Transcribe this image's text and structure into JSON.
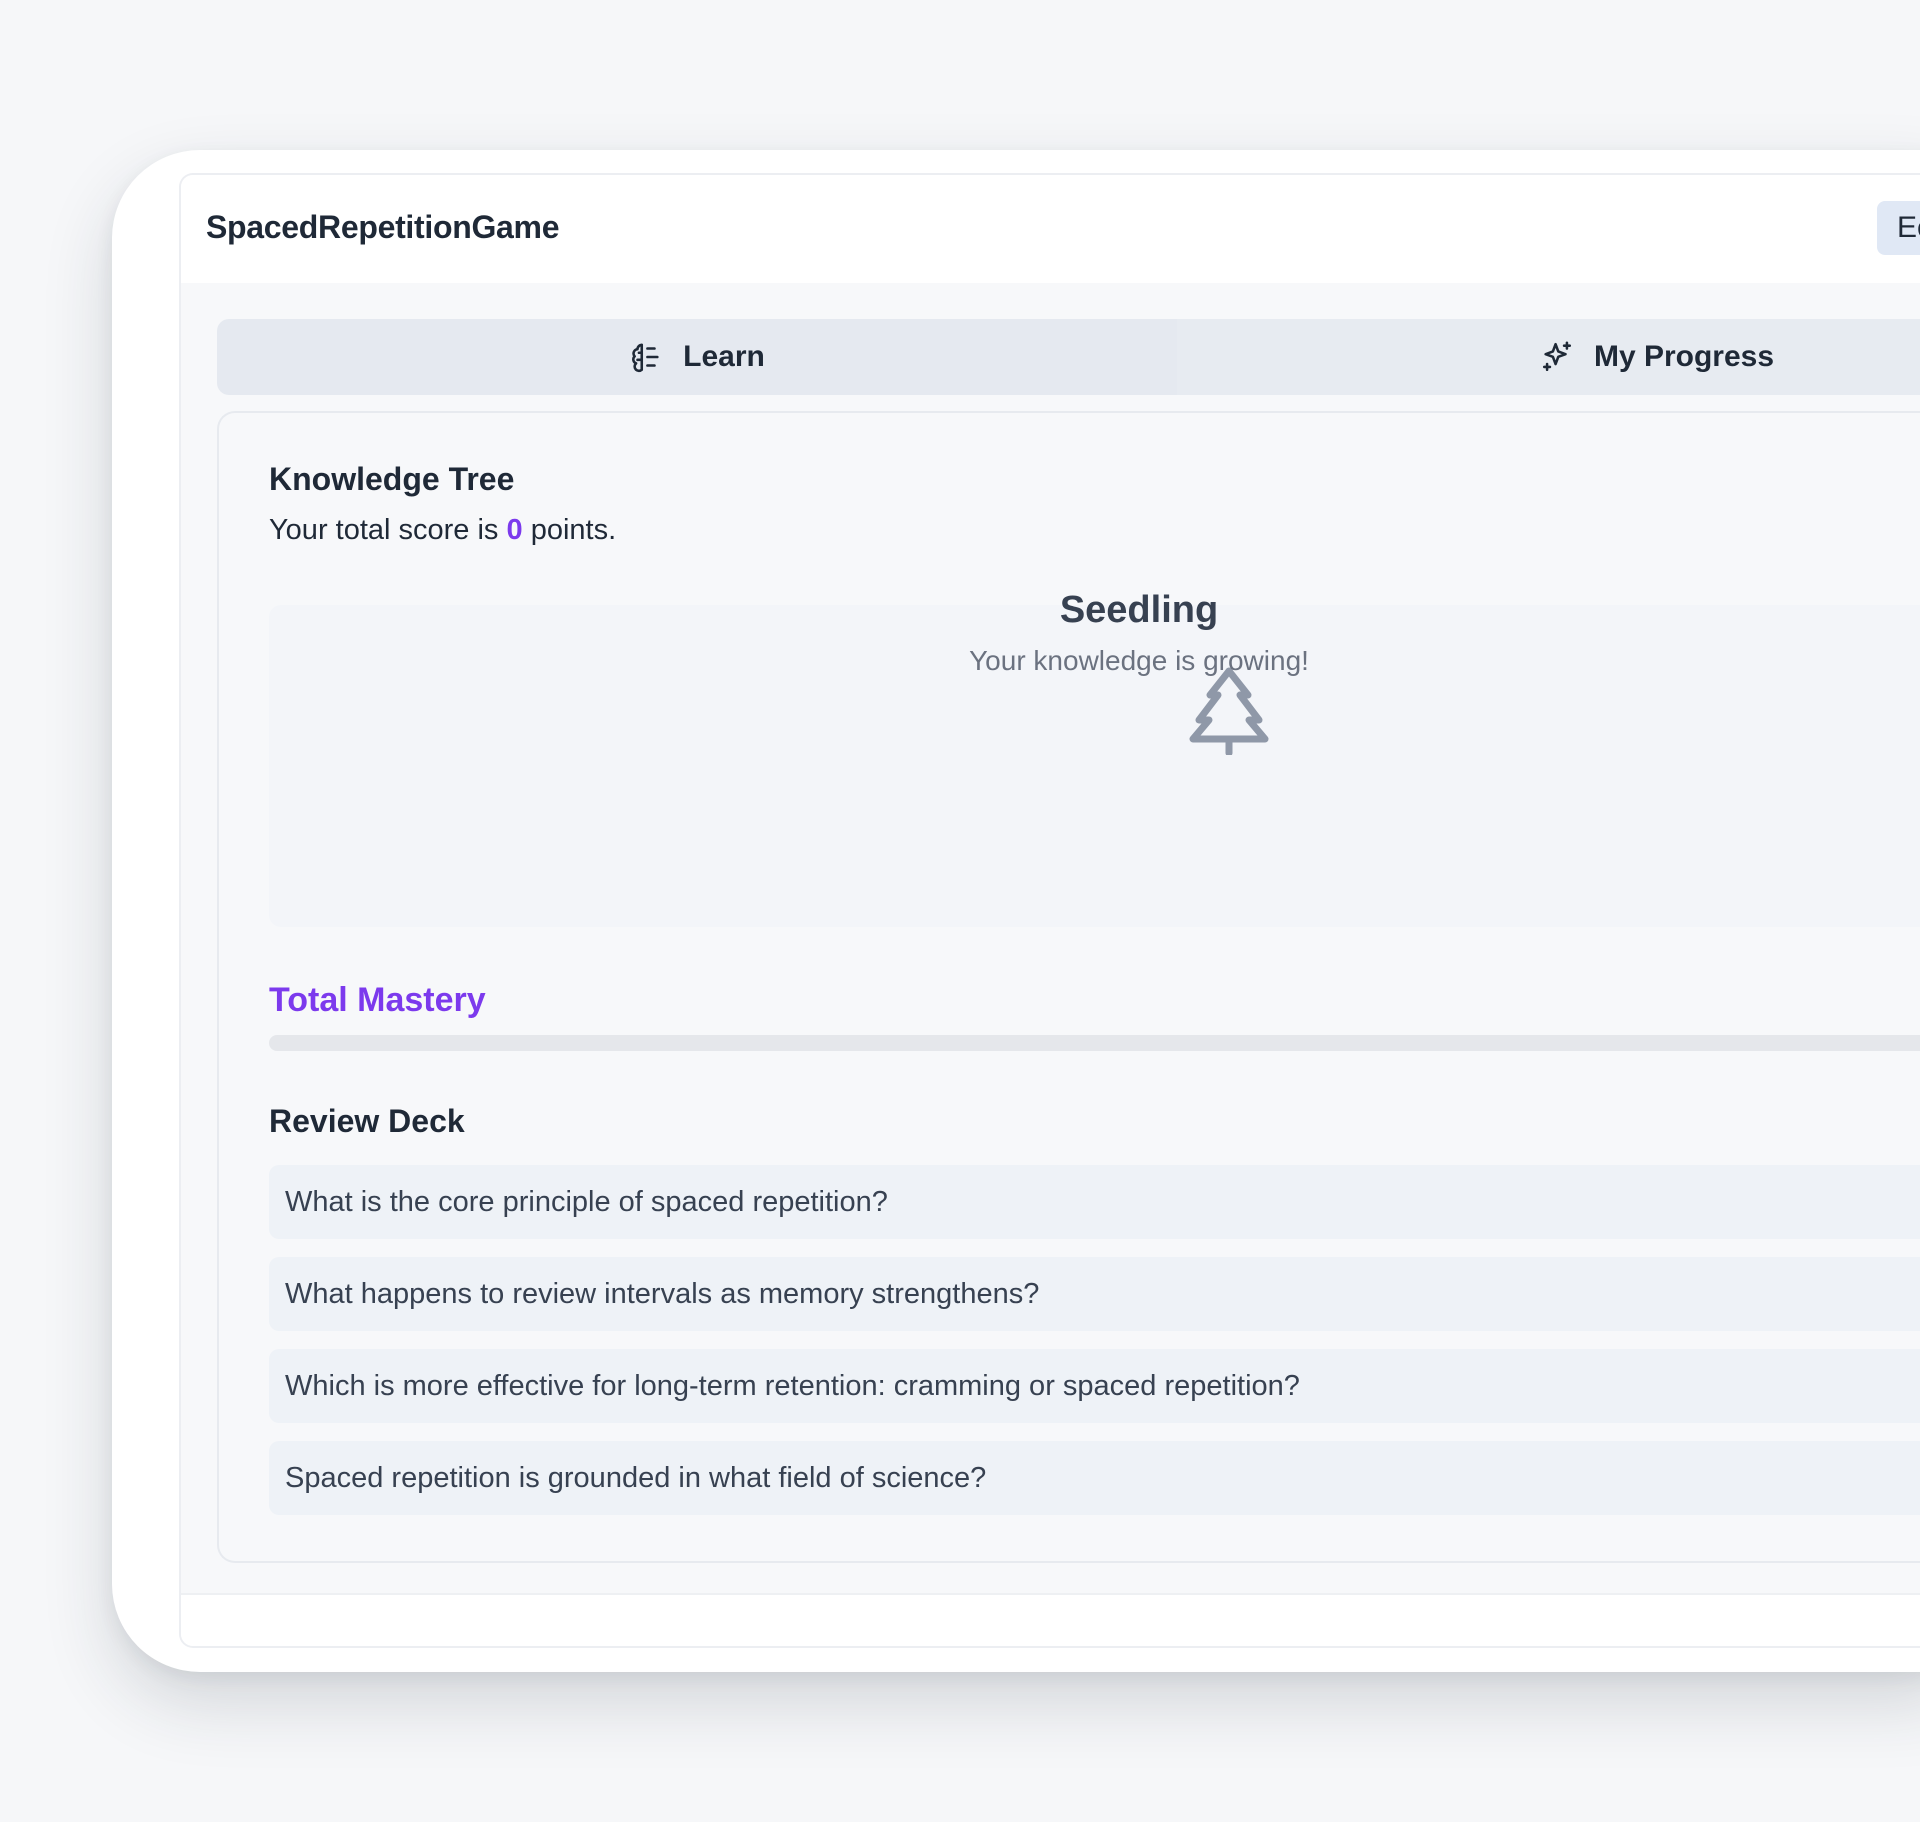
{
  "app": {
    "title": "SpacedRepetitionGame",
    "header_button_label": "Ec"
  },
  "tabs": [
    {
      "label": "Learn",
      "icon": "brain-icon",
      "selected": false
    },
    {
      "label": "My Progress",
      "icon": "sparkles-icon",
      "selected": true
    }
  ],
  "knowledge_tree": {
    "title": "Knowledge Tree",
    "score_prefix": "Your total score is ",
    "score_value": "0",
    "score_suffix": " points.",
    "stage_icon": "tree-icon",
    "stage_name": "Seedling",
    "stage_description": "Your knowledge is growing!"
  },
  "mastery": {
    "label": "Total Mastery",
    "progress_percent": 0
  },
  "review_deck": {
    "title": "Review Deck",
    "items": [
      "What is the core principle of spaced repetition?",
      "What happens to review intervals as memory strengthens?",
      "Which is more effective for long-term retention: cramming or spaced repetition?",
      "Spaced repetition is grounded in what field of science?"
    ]
  },
  "colors": {
    "accent": "#7c3aed",
    "tab_bar": "#e5e9f0",
    "header_button": "#e0e8f5",
    "muted_text": "#6b7280",
    "icon_gray": "#8f98a8"
  }
}
